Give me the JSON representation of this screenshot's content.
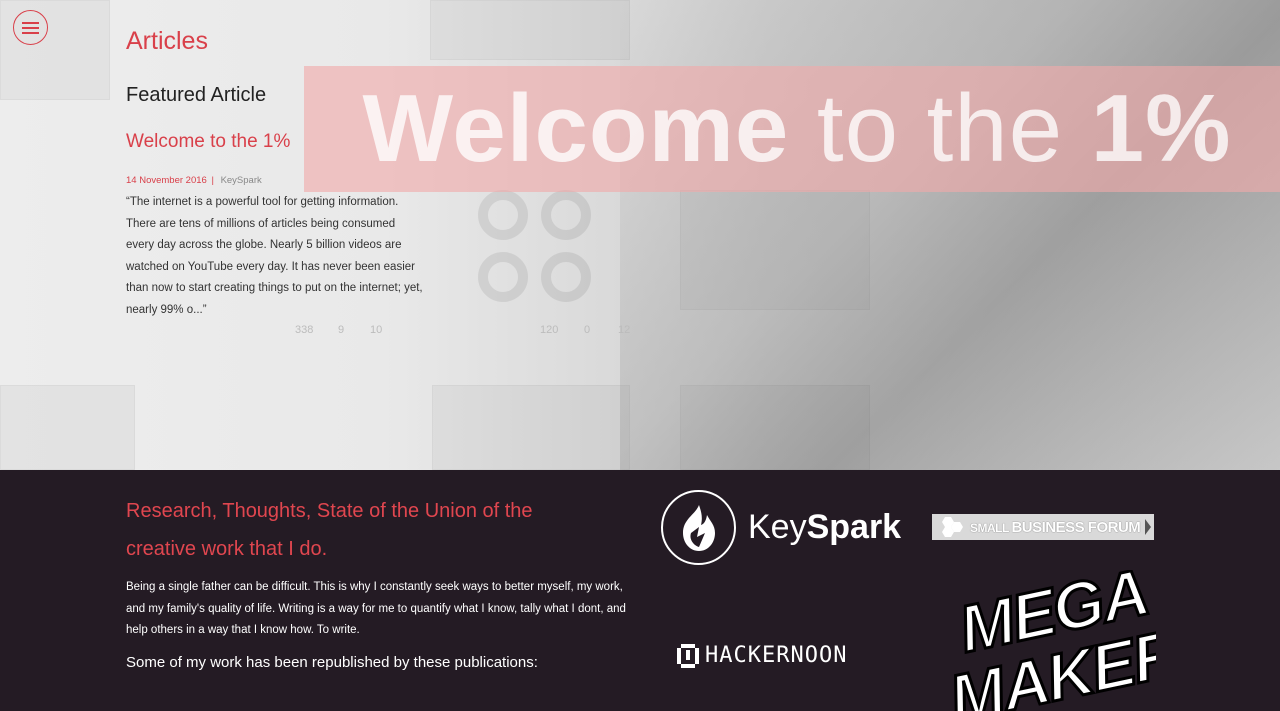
{
  "hero": {
    "menu_label": "Menu",
    "section_title": "Articles",
    "featured_label": "Featured Article",
    "banner_bold_1": "Welcome",
    "banner_light": " to the ",
    "banner_bold_2": "1%",
    "featured_article": {
      "title": "Welcome to the 1%",
      "date": "14 November 2016",
      "separator": "|",
      "author": "KeySpark",
      "excerpt": "“The internet is a powerful tool for getting information. There are tens of millions of articles being consumed every day across the globe. Nearly 5 billion videos are watched on YouTube every day. It has never been easier than now to start creating things to put on the internet; yet, nearly 99% o...”"
    },
    "background_stats": [
      "338",
      "9",
      "10",
      "120",
      "0",
      "12"
    ]
  },
  "about": {
    "heading": "Research, Thoughts, State of the Union of the creative work that I do.",
    "body": "Being a single father can be difficult. This is why I constantly seek ways to better myself, my work, and my family's quality of life. Writing is a way for me to quantify what I know, tally what I dont, and help others in a way that I know how. To write.",
    "publications_note": "Some of my work has been republished by these publications:"
  },
  "publications": {
    "keyspark": {
      "light": "Key",
      "bold": "Spark"
    },
    "small_business_forum": {
      "small": "SMALL ",
      "bold": "BUSINESS FORUM"
    },
    "hackernoon": "HACKERNOON",
    "megamaker": "MEGA MAKER"
  },
  "colors": {
    "accent": "#d9404a",
    "dark_bg": "#241b24",
    "banner": "#f0aaaa"
  }
}
